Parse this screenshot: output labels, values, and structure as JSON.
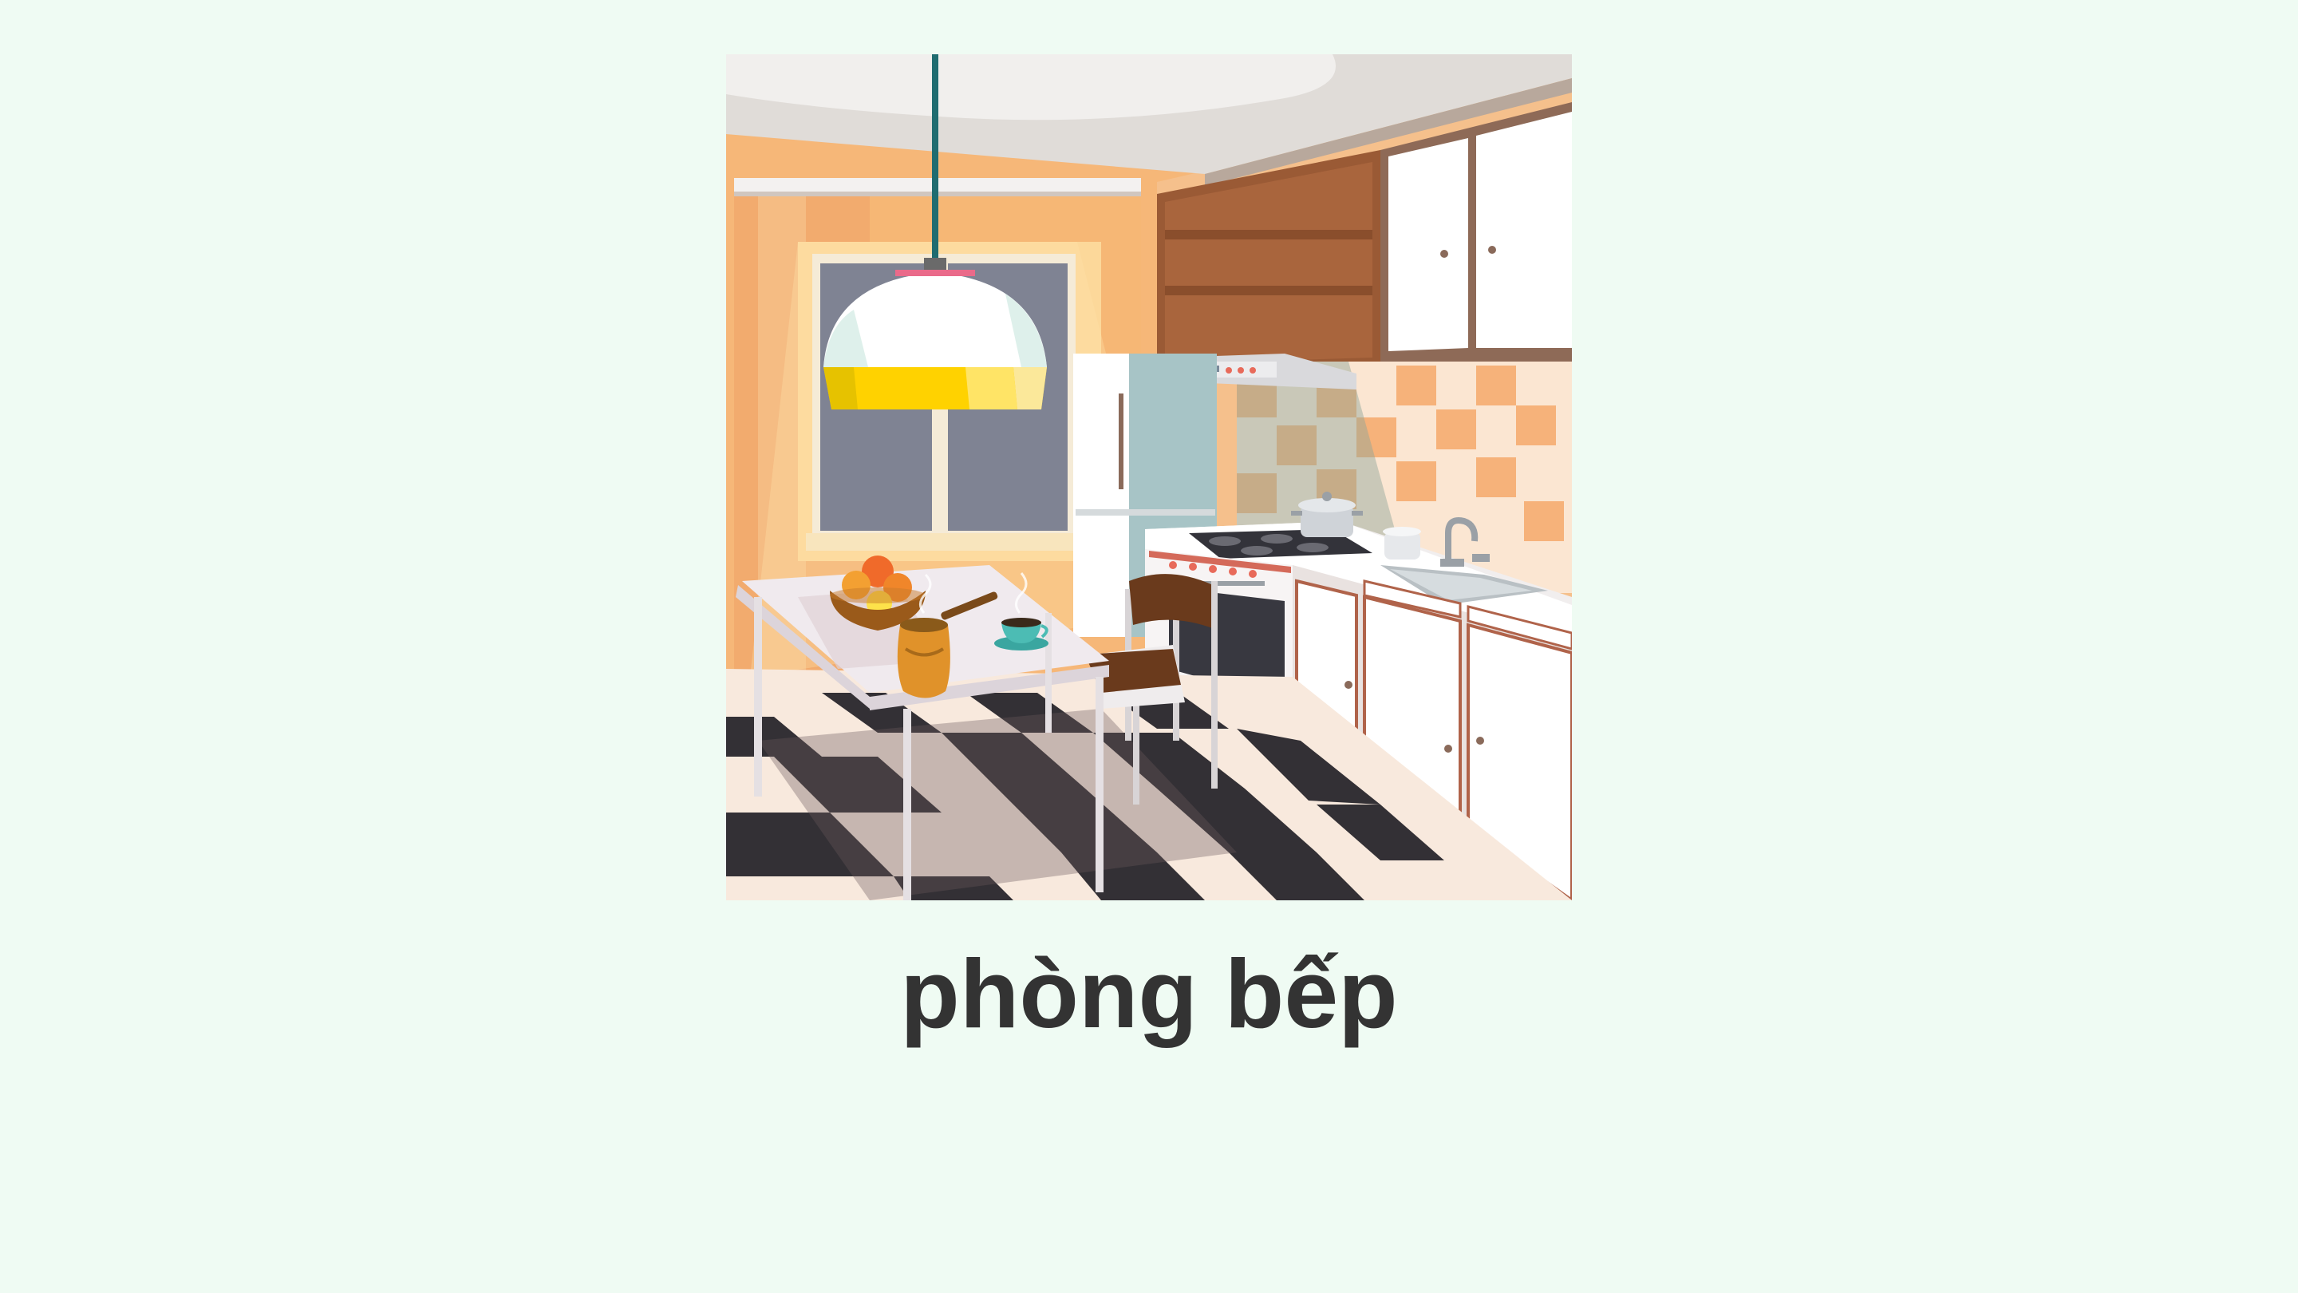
{
  "background_color": "#effbf3",
  "caption": {
    "text": "phòng bếp",
    "color": "#333333"
  },
  "illustration": {
    "subject": "kitchen-scene",
    "icons": [
      "pendant-lamp-icon",
      "window-icon",
      "refrigerator-icon",
      "cabinet-icon",
      "range-hood-icon",
      "stove-icon",
      "oven-icon",
      "sink-icon",
      "faucet-icon",
      "pot-icon",
      "table-icon",
      "chair-icon",
      "fruit-bowl-icon",
      "coffee-pot-icon",
      "teacup-icon"
    ]
  }
}
